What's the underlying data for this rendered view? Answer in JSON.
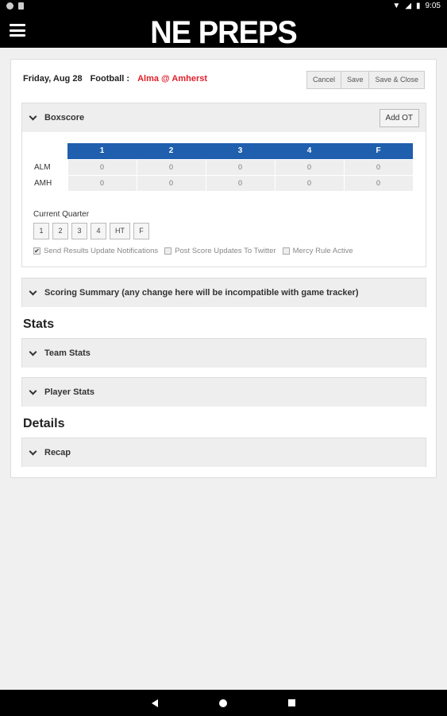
{
  "status_bar": {
    "time": "9:05"
  },
  "app": {
    "title": "NE PREPS"
  },
  "game": {
    "date": "Friday, Aug 28",
    "sport": "Football :",
    "matchup": "Alma @ Amherst"
  },
  "actions": {
    "cancel": "Cancel",
    "save": "Save",
    "save_close": "Save & Close"
  },
  "boxscore": {
    "title": "Boxscore",
    "add_ot": "Add OT",
    "columns": [
      "1",
      "2",
      "3",
      "4",
      "F"
    ],
    "rows": [
      {
        "team": "ALM",
        "scores": [
          "0",
          "0",
          "0",
          "0",
          "0"
        ]
      },
      {
        "team": "AMH",
        "scores": [
          "0",
          "0",
          "0",
          "0",
          "0"
        ]
      }
    ],
    "current_quarter_label": "Current Quarter",
    "quarter_buttons": [
      "1",
      "2",
      "3",
      "4",
      "HT",
      "F"
    ],
    "checkboxes": [
      {
        "label": "Send Results Update Notifications",
        "checked": true
      },
      {
        "label": "Post Score Updates To Twitter",
        "checked": false
      },
      {
        "label": "Mercy Rule Active",
        "checked": false
      }
    ]
  },
  "scoring_summary": {
    "title": "Scoring Summary (any change here will be incompatible with game tracker)"
  },
  "stats": {
    "heading": "Stats",
    "team_stats": "Team Stats",
    "player_stats": "Player Stats"
  },
  "details": {
    "heading": "Details",
    "recap": "Recap"
  },
  "colors": {
    "header": "#1f5fae",
    "matchup": "#e0202a"
  }
}
